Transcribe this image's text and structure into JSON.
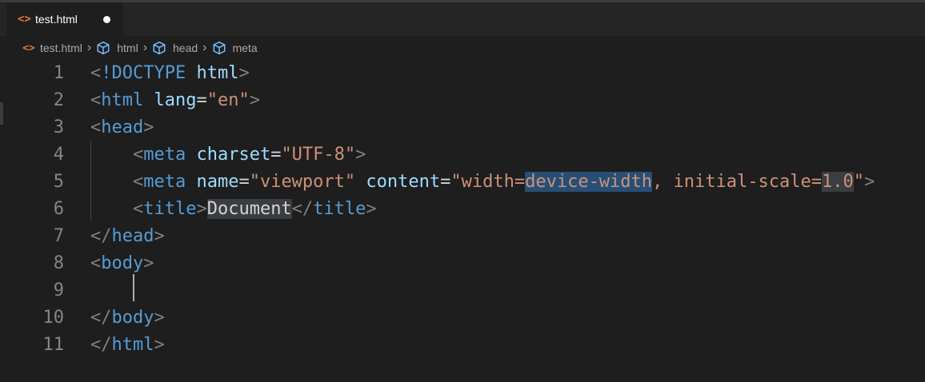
{
  "tab": {
    "label": "test.html",
    "icon": "html-file-icon",
    "modified": true
  },
  "breadcrumb": [
    {
      "label": "test.html",
      "icon": "html-file-icon"
    },
    {
      "label": "html",
      "icon": "cube-icon"
    },
    {
      "label": "head",
      "icon": "cube-icon"
    },
    {
      "label": "meta",
      "icon": "cube-icon"
    }
  ],
  "colors": {
    "tag": "#569cd6",
    "attribute": "#9cdcfe",
    "string": "#ce9178",
    "punctuation": "#808080",
    "text": "#d4d4d4",
    "selection": "#264f78",
    "line_number": "#858585",
    "html_icon": "#e37933"
  },
  "lines": [
    {
      "number": "1",
      "tokens": [
        {
          "t": "<",
          "c": "punct"
        },
        {
          "t": "!DOCTYPE",
          "c": "tag"
        },
        {
          "t": " ",
          "c": "text"
        },
        {
          "t": "html",
          "c": "attr"
        },
        {
          "t": ">",
          "c": "punct"
        }
      ]
    },
    {
      "number": "2",
      "tokens": [
        {
          "t": "<",
          "c": "punct"
        },
        {
          "t": "html",
          "c": "tag"
        },
        {
          "t": " ",
          "c": "text"
        },
        {
          "t": "lang",
          "c": "attr"
        },
        {
          "t": "=",
          "c": "text"
        },
        {
          "t": "\"en\"",
          "c": "str"
        },
        {
          "t": ">",
          "c": "punct"
        }
      ]
    },
    {
      "number": "3",
      "tokens": [
        {
          "t": "<",
          "c": "punct"
        },
        {
          "t": "head",
          "c": "tag"
        },
        {
          "t": ">",
          "c": "punct"
        }
      ]
    },
    {
      "number": "4",
      "tokens": [
        {
          "t": "    ",
          "c": "text"
        },
        {
          "t": "<",
          "c": "punct"
        },
        {
          "t": "meta",
          "c": "tag"
        },
        {
          "t": " ",
          "c": "text"
        },
        {
          "t": "charset",
          "c": "attr"
        },
        {
          "t": "=",
          "c": "text"
        },
        {
          "t": "\"UTF-8\"",
          "c": "str"
        },
        {
          "t": ">",
          "c": "punct"
        }
      ]
    },
    {
      "number": "5",
      "tokens": [
        {
          "t": "    ",
          "c": "text"
        },
        {
          "t": "<",
          "c": "punct"
        },
        {
          "t": "meta",
          "c": "tag"
        },
        {
          "t": " ",
          "c": "text"
        },
        {
          "t": "name",
          "c": "attr"
        },
        {
          "t": "=",
          "c": "text"
        },
        {
          "t": "\"viewport\"",
          "c": "str"
        },
        {
          "t": " ",
          "c": "text"
        },
        {
          "t": "content",
          "c": "attr"
        },
        {
          "t": "=",
          "c": "text"
        },
        {
          "t": "\"width=",
          "c": "str"
        },
        {
          "t": "device-width",
          "c": "str",
          "hl": "sel"
        },
        {
          "t": ", initial-scale=",
          "c": "str"
        },
        {
          "t": "1.0",
          "c": "str",
          "hl": "hl"
        },
        {
          "t": "\"",
          "c": "str"
        },
        {
          "t": ">",
          "c": "punct"
        }
      ]
    },
    {
      "number": "6",
      "tokens": [
        {
          "t": "    ",
          "c": "text"
        },
        {
          "t": "<",
          "c": "punct"
        },
        {
          "t": "title",
          "c": "tag"
        },
        {
          "t": ">",
          "c": "punct"
        },
        {
          "t": "Document",
          "c": "text",
          "hl": "hl"
        },
        {
          "t": "</",
          "c": "punct"
        },
        {
          "t": "title",
          "c": "tag"
        },
        {
          "t": ">",
          "c": "punct"
        }
      ]
    },
    {
      "number": "7",
      "tokens": [
        {
          "t": "</",
          "c": "punct"
        },
        {
          "t": "head",
          "c": "tag"
        },
        {
          "t": ">",
          "c": "punct"
        }
      ]
    },
    {
      "number": "8",
      "tokens": [
        {
          "t": "<",
          "c": "punct"
        },
        {
          "t": "body",
          "c": "tag"
        },
        {
          "t": ">",
          "c": "punct"
        }
      ]
    },
    {
      "number": "9",
      "tokens": []
    },
    {
      "number": "10",
      "tokens": [
        {
          "t": "</",
          "c": "punct"
        },
        {
          "t": "body",
          "c": "tag"
        },
        {
          "t": ">",
          "c": "punct"
        }
      ]
    },
    {
      "number": "11",
      "tokens": [
        {
          "t": "</",
          "c": "punct"
        },
        {
          "t": "html",
          "c": "tag"
        },
        {
          "t": ">",
          "c": "punct"
        }
      ]
    }
  ]
}
